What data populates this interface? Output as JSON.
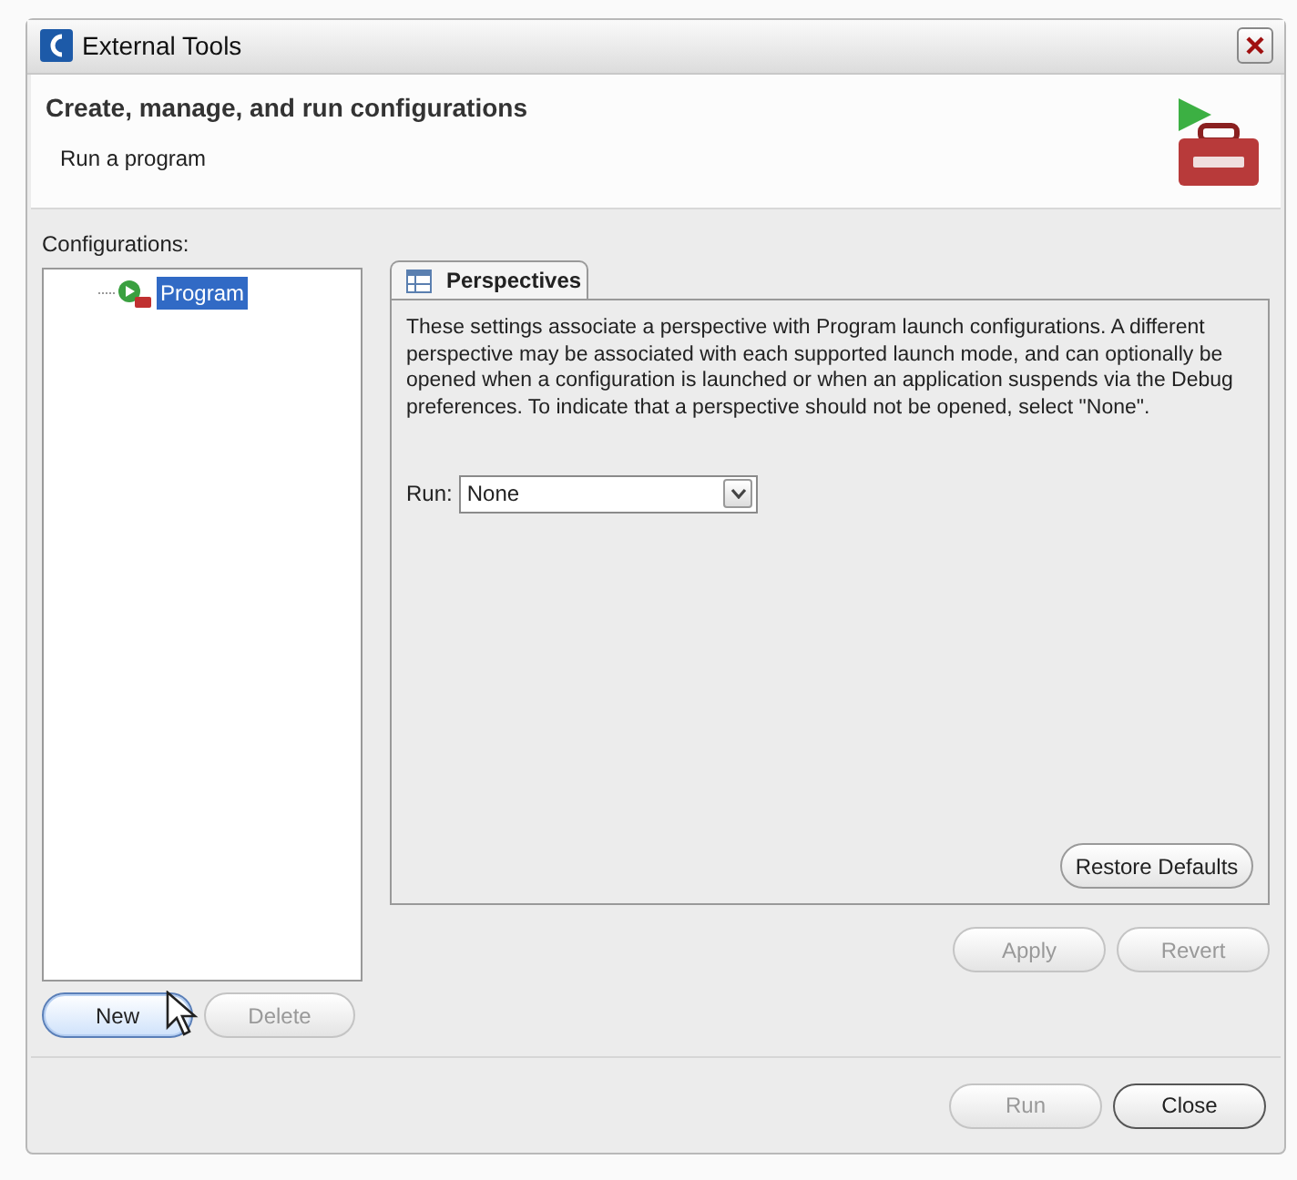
{
  "window": {
    "title": "External Tools"
  },
  "header": {
    "title": "Create, manage, and run configurations",
    "subtitle": "Run a program"
  },
  "configurations": {
    "label": "Configurations:",
    "items": [
      {
        "label": "Program",
        "selected": true
      }
    ],
    "buttons": [
      {
        "label": "New",
        "disabled": false,
        "hovered": true
      },
      {
        "label": "Delete",
        "disabled": true,
        "hovered": false
      }
    ]
  },
  "tabs": [
    {
      "label": "Perspectives",
      "selected": true
    }
  ],
  "perspectives": {
    "description": "These settings associate a perspective with Program launch configurations. A different perspective may be associated with each supported launch mode, and can optionally be opened when a configuration is launched or when an application suspends via the Debug preferences. To indicate that a perspective should not be opened, select \"None\".",
    "run_label": "Run:",
    "run_value": "None"
  },
  "restore_button": {
    "label": "Restore Defaults",
    "disabled": false
  },
  "apply_buttons": [
    {
      "label": "Apply",
      "disabled": true
    },
    {
      "label": "Revert",
      "disabled": true
    }
  ],
  "dialog_buttons": [
    {
      "label": "Run",
      "disabled": true
    },
    {
      "label": "Close",
      "disabled": false
    }
  ]
}
